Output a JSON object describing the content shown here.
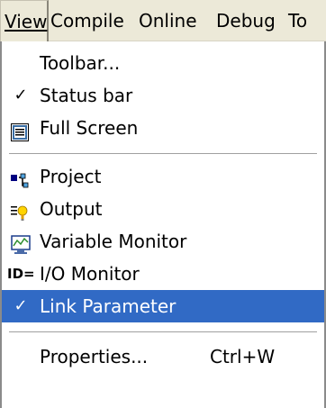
{
  "menubar": {
    "items": [
      {
        "label": "View"
      },
      {
        "label": "Compile"
      },
      {
        "label": "Online"
      },
      {
        "label": "Debug"
      },
      {
        "label": "To"
      }
    ]
  },
  "menu": {
    "toolbar": "Toolbar...",
    "status_bar": "Status bar",
    "full_screen": "Full Screen",
    "project": "Project",
    "output": "Output",
    "variable_monitor": "Variable Monitor",
    "io_monitor": "I/O Monitor",
    "io_prefix": "ID=",
    "link_parameter": "Link Parameter",
    "properties": "Properties...",
    "properties_shortcut": "Ctrl+W",
    "check_glyph": "✓"
  },
  "colors": {
    "highlight": "#316ac5",
    "menubar_bg": "#ece9d8"
  },
  "icons": {
    "full_screen": "full-screen-icon",
    "project": "project-icon",
    "output": "output-icon",
    "variable_monitor": "variable-monitor-icon",
    "io_monitor": "io-monitor-icon"
  }
}
